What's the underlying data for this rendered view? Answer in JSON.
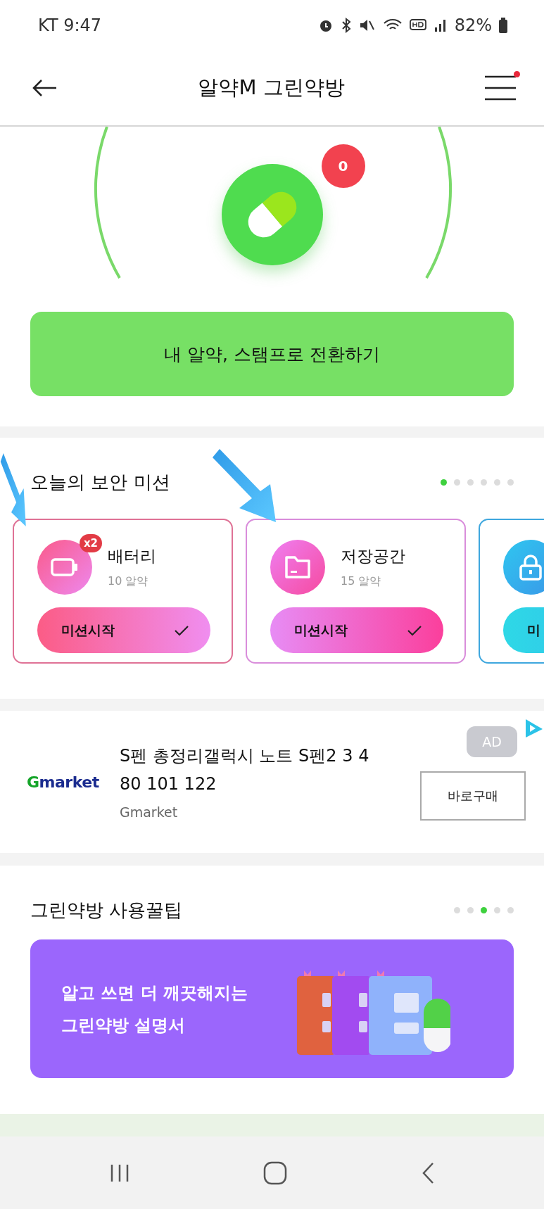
{
  "status_bar": {
    "carrier_time": "KT 9:47",
    "battery": "82%"
  },
  "header": {
    "title": "알약M 그린약방",
    "menu_notification": true
  },
  "pill_counter": {
    "count": "0"
  },
  "convert_button": "내 알약, 스탬프로 전환하기",
  "missions": {
    "title": "오늘의 보안 미션",
    "dots": [
      {
        "selected": true
      },
      {
        "selected": false
      },
      {
        "selected": false
      },
      {
        "selected": false
      },
      {
        "selected": false
      },
      {
        "selected": false
      }
    ],
    "cards": [
      {
        "kind": "battery",
        "title": "배터리",
        "reward": "10 알약",
        "multiplier": "x2",
        "button": "미션시작"
      },
      {
        "kind": "folder",
        "title": "저장공간",
        "reward": "15 알약",
        "button": "미션시작"
      },
      {
        "kind": "lock",
        "button": "미"
      }
    ]
  },
  "ad": {
    "brand_logo": "Gmarket",
    "title_lines": [
      "S펜 총정리갤럭시 노트 S펜2 3 4",
      "80 101 122"
    ],
    "source": "Gmarket",
    "badge": "AD",
    "buy_button": "바로구매"
  },
  "tips": {
    "title": "그린약방 사용꿀팁",
    "dots": [
      {
        "selected": false
      },
      {
        "selected": false
      },
      {
        "selected": true
      },
      {
        "selected": false
      },
      {
        "selected": false
      }
    ],
    "banner_lines": [
      "알고 쓰면 더 깨끗해지는",
      "그린약방 설명서"
    ]
  }
}
